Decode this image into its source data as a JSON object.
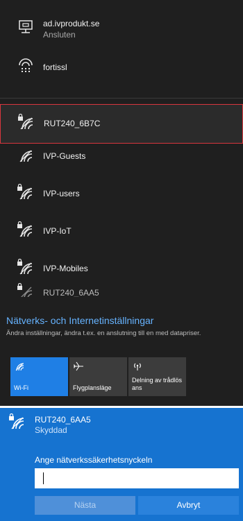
{
  "connected": [
    {
      "name": "ad.ivprodukt.se",
      "status": "Ansluten",
      "icon": "ethernet-icon"
    },
    {
      "name": "fortissl",
      "status": "",
      "icon": "dialup-icon"
    }
  ],
  "networks": [
    {
      "name": "RUT240_6B7C",
      "secured": true,
      "selected": true,
      "icon": "wifi-secured-icon"
    },
    {
      "name": "IVP-Guests",
      "secured": false,
      "selected": false,
      "icon": "wifi-icon"
    },
    {
      "name": "IVP-users",
      "secured": true,
      "selected": false,
      "icon": "wifi-secured-icon"
    },
    {
      "name": "IVP-IoT",
      "secured": true,
      "selected": false,
      "icon": "wifi-secured-icon"
    },
    {
      "name": "IVP-Mobiles",
      "secured": true,
      "selected": false,
      "icon": "wifi-secured-icon"
    },
    {
      "name": "RUT240_6AA5",
      "secured": true,
      "selected": false,
      "icon": "wifi-secured-icon"
    }
  ],
  "settings": {
    "link": "Nätverks- och Internetinställningar",
    "description": "Ändra inställningar, ändra t.ex. en anslutning till en med datapriser."
  },
  "quick_actions": [
    {
      "label": "Wi-Fi",
      "active": true,
      "icon": "wifi-icon"
    },
    {
      "label": "Flygplansläge",
      "active": false,
      "icon": "airplane-icon"
    },
    {
      "label": "Delning av trådlös ans",
      "active": false,
      "icon": "hotspot-icon"
    }
  ],
  "dialog": {
    "network_name": "RUT240_6AA5",
    "status": "Skyddad",
    "prompt": "Ange nätverkssäkerhetsnyckeln",
    "key_value": "",
    "next_label": "Nästa",
    "cancel_label": "Avbryt"
  },
  "colors": {
    "flyout_bg": "#1f1f1f",
    "accent": "#1f7fe5",
    "dialog_bg": "#1673d0",
    "link": "#66b3ff",
    "selected_border": "#d9363e"
  }
}
